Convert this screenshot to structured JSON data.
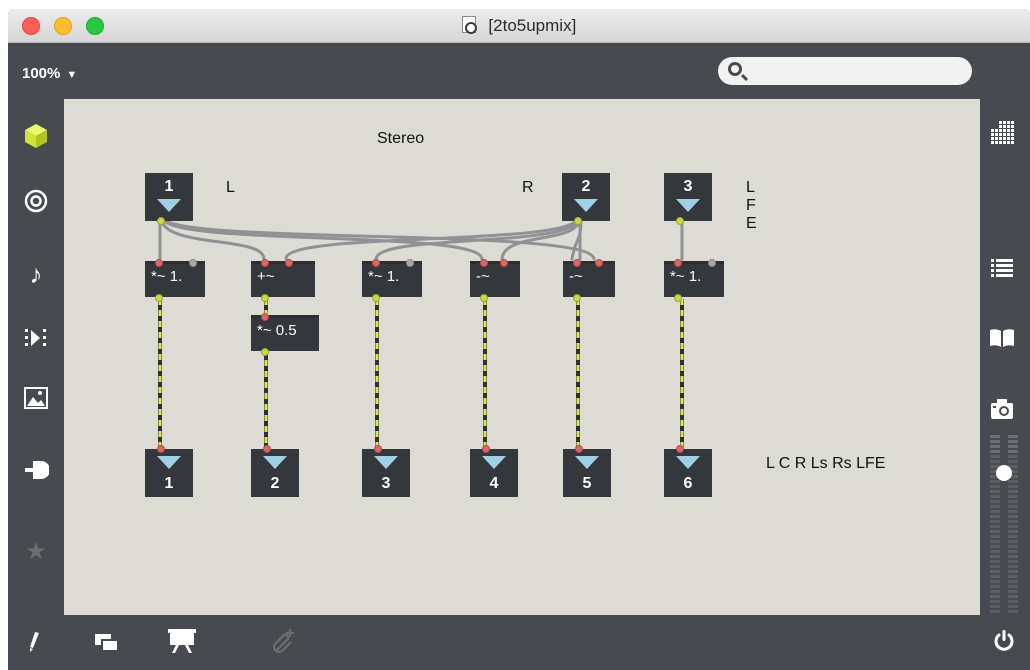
{
  "window": {
    "title": "[2to5upmix]"
  },
  "toolbar": {
    "zoom": "100%",
    "search_placeholder": ""
  },
  "sidebar_left": [
    "package-icon",
    "target-icon",
    "music-note-icon",
    "media-step-icon",
    "image-icon",
    "plug-icon",
    "star-icon"
  ],
  "sidebar_right": [
    "grid-icon",
    "list-icon",
    "book-icon",
    "camera-icon",
    "meter-icon"
  ],
  "bottom_bar": [
    "pencil-icon",
    "windows-icon",
    "presentation-icon",
    "add-clip-icon",
    "power-icon"
  ],
  "patch": {
    "comments": {
      "stereo": "Stereo",
      "left": "L",
      "right": "R",
      "lfe": "L\nF\nE",
      "outputs": "L C R Ls Rs LFE"
    },
    "inlets": [
      {
        "num": "1"
      },
      {
        "num": "2"
      },
      {
        "num": "3"
      }
    ],
    "objects": [
      {
        "text": "*~ 1."
      },
      {
        "text": "+~"
      },
      {
        "text": "*~ 0.5"
      },
      {
        "text": "*~ 1."
      },
      {
        "text": "-~"
      },
      {
        "text": "-~"
      },
      {
        "text": "*~ 1."
      }
    ],
    "outlets": [
      {
        "num": "1"
      },
      {
        "num": "2"
      },
      {
        "num": "3"
      },
      {
        "num": "4"
      },
      {
        "num": "5"
      },
      {
        "num": "6"
      }
    ]
  },
  "colors": {
    "canvas": "#dcdcd5",
    "object": "#34373b",
    "signal_cord": "#c8d84a",
    "audio_cord": "#9a9a9a",
    "inlet_port": "#d46a6a",
    "chrome": "#474a4e",
    "accent_cube": "#d8ef3c"
  }
}
